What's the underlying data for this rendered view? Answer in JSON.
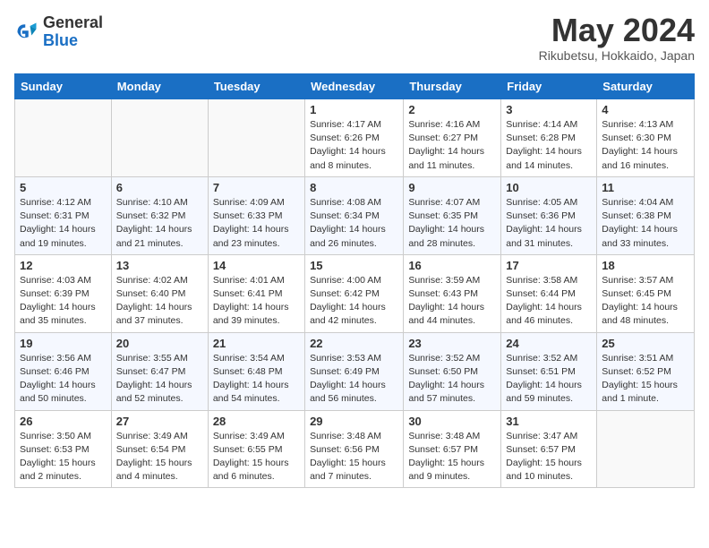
{
  "header": {
    "logo_general": "General",
    "logo_blue": "Blue",
    "title": "May 2024",
    "location": "Rikubetsu, Hokkaido, Japan"
  },
  "days_of_week": [
    "Sunday",
    "Monday",
    "Tuesday",
    "Wednesday",
    "Thursday",
    "Friday",
    "Saturday"
  ],
  "weeks": [
    [
      {
        "day": "",
        "info": ""
      },
      {
        "day": "",
        "info": ""
      },
      {
        "day": "",
        "info": ""
      },
      {
        "day": "1",
        "info": "Sunrise: 4:17 AM\nSunset: 6:26 PM\nDaylight: 14 hours\nand 8 minutes."
      },
      {
        "day": "2",
        "info": "Sunrise: 4:16 AM\nSunset: 6:27 PM\nDaylight: 14 hours\nand 11 minutes."
      },
      {
        "day": "3",
        "info": "Sunrise: 4:14 AM\nSunset: 6:28 PM\nDaylight: 14 hours\nand 14 minutes."
      },
      {
        "day": "4",
        "info": "Sunrise: 4:13 AM\nSunset: 6:30 PM\nDaylight: 14 hours\nand 16 minutes."
      }
    ],
    [
      {
        "day": "5",
        "info": "Sunrise: 4:12 AM\nSunset: 6:31 PM\nDaylight: 14 hours\nand 19 minutes."
      },
      {
        "day": "6",
        "info": "Sunrise: 4:10 AM\nSunset: 6:32 PM\nDaylight: 14 hours\nand 21 minutes."
      },
      {
        "day": "7",
        "info": "Sunrise: 4:09 AM\nSunset: 6:33 PM\nDaylight: 14 hours\nand 23 minutes."
      },
      {
        "day": "8",
        "info": "Sunrise: 4:08 AM\nSunset: 6:34 PM\nDaylight: 14 hours\nand 26 minutes."
      },
      {
        "day": "9",
        "info": "Sunrise: 4:07 AM\nSunset: 6:35 PM\nDaylight: 14 hours\nand 28 minutes."
      },
      {
        "day": "10",
        "info": "Sunrise: 4:05 AM\nSunset: 6:36 PM\nDaylight: 14 hours\nand 31 minutes."
      },
      {
        "day": "11",
        "info": "Sunrise: 4:04 AM\nSunset: 6:38 PM\nDaylight: 14 hours\nand 33 minutes."
      }
    ],
    [
      {
        "day": "12",
        "info": "Sunrise: 4:03 AM\nSunset: 6:39 PM\nDaylight: 14 hours\nand 35 minutes."
      },
      {
        "day": "13",
        "info": "Sunrise: 4:02 AM\nSunset: 6:40 PM\nDaylight: 14 hours\nand 37 minutes."
      },
      {
        "day": "14",
        "info": "Sunrise: 4:01 AM\nSunset: 6:41 PM\nDaylight: 14 hours\nand 39 minutes."
      },
      {
        "day": "15",
        "info": "Sunrise: 4:00 AM\nSunset: 6:42 PM\nDaylight: 14 hours\nand 42 minutes."
      },
      {
        "day": "16",
        "info": "Sunrise: 3:59 AM\nSunset: 6:43 PM\nDaylight: 14 hours\nand 44 minutes."
      },
      {
        "day": "17",
        "info": "Sunrise: 3:58 AM\nSunset: 6:44 PM\nDaylight: 14 hours\nand 46 minutes."
      },
      {
        "day": "18",
        "info": "Sunrise: 3:57 AM\nSunset: 6:45 PM\nDaylight: 14 hours\nand 48 minutes."
      }
    ],
    [
      {
        "day": "19",
        "info": "Sunrise: 3:56 AM\nSunset: 6:46 PM\nDaylight: 14 hours\nand 50 minutes."
      },
      {
        "day": "20",
        "info": "Sunrise: 3:55 AM\nSunset: 6:47 PM\nDaylight: 14 hours\nand 52 minutes."
      },
      {
        "day": "21",
        "info": "Sunrise: 3:54 AM\nSunset: 6:48 PM\nDaylight: 14 hours\nand 54 minutes."
      },
      {
        "day": "22",
        "info": "Sunrise: 3:53 AM\nSunset: 6:49 PM\nDaylight: 14 hours\nand 56 minutes."
      },
      {
        "day": "23",
        "info": "Sunrise: 3:52 AM\nSunset: 6:50 PM\nDaylight: 14 hours\nand 57 minutes."
      },
      {
        "day": "24",
        "info": "Sunrise: 3:52 AM\nSunset: 6:51 PM\nDaylight: 14 hours\nand 59 minutes."
      },
      {
        "day": "25",
        "info": "Sunrise: 3:51 AM\nSunset: 6:52 PM\nDaylight: 15 hours\nand 1 minute."
      }
    ],
    [
      {
        "day": "26",
        "info": "Sunrise: 3:50 AM\nSunset: 6:53 PM\nDaylight: 15 hours\nand 2 minutes."
      },
      {
        "day": "27",
        "info": "Sunrise: 3:49 AM\nSunset: 6:54 PM\nDaylight: 15 hours\nand 4 minutes."
      },
      {
        "day": "28",
        "info": "Sunrise: 3:49 AM\nSunset: 6:55 PM\nDaylight: 15 hours\nand 6 minutes."
      },
      {
        "day": "29",
        "info": "Sunrise: 3:48 AM\nSunset: 6:56 PM\nDaylight: 15 hours\nand 7 minutes."
      },
      {
        "day": "30",
        "info": "Sunrise: 3:48 AM\nSunset: 6:57 PM\nDaylight: 15 hours\nand 9 minutes."
      },
      {
        "day": "31",
        "info": "Sunrise: 3:47 AM\nSunset: 6:57 PM\nDaylight: 15 hours\nand 10 minutes."
      },
      {
        "day": "",
        "info": ""
      }
    ]
  ]
}
